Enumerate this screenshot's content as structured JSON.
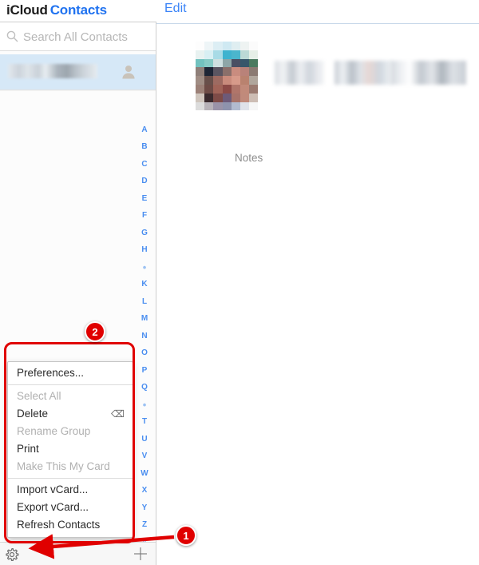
{
  "window": {
    "title_prefix": "iCloud",
    "app_name": "Contacts",
    "chevron": "ⱟ"
  },
  "detail_header": {
    "edit_label": "Edit"
  },
  "search": {
    "placeholder": "Search All Contacts",
    "value": "",
    "icon": "search-icon"
  },
  "contact_list": {
    "selected_row": {
      "name_redacted": "",
      "icon": "person-icon"
    }
  },
  "alpha_index": {
    "items": [
      "A",
      "B",
      "C",
      "D",
      "E",
      "F",
      "G",
      "H",
      "•",
      "K",
      "L",
      "M",
      "N",
      "O",
      "P",
      "Q",
      "•",
      "T",
      "U",
      "V",
      "W",
      "X",
      "Y",
      "Z",
      "#"
    ]
  },
  "bottom_toolbar": {
    "settings_icon": "gear-icon",
    "add_icon": "plus-icon"
  },
  "context_menu": {
    "items": [
      {
        "label": "Preferences...",
        "enabled": true,
        "shortcut": "",
        "separator_after": true
      },
      {
        "label": "Select All",
        "enabled": false,
        "shortcut": "",
        "separator_after": false
      },
      {
        "label": "Delete",
        "enabled": true,
        "shortcut": "⌫",
        "separator_after": false
      },
      {
        "label": "Rename Group",
        "enabled": false,
        "shortcut": "",
        "separator_after": false
      },
      {
        "label": "Print",
        "enabled": true,
        "shortcut": "",
        "separator_after": false
      },
      {
        "label": "Make This My Card",
        "enabled": false,
        "shortcut": "",
        "separator_after": true
      },
      {
        "label": "Import vCard...",
        "enabled": true,
        "shortcut": "",
        "separator_after": false
      },
      {
        "label": "Export vCard...",
        "enabled": true,
        "shortcut": "",
        "separator_after": false
      },
      {
        "label": "Refresh Contacts",
        "enabled": true,
        "shortcut": "",
        "separator_after": false
      }
    ]
  },
  "detail_pane": {
    "avatar_redacted": "",
    "name_parts_redacted": [
      "",
      "",
      ""
    ],
    "notes_label": "Notes"
  },
  "annotations": {
    "badge_1": "1",
    "badge_2": "2",
    "accent_color": "#e00000"
  }
}
